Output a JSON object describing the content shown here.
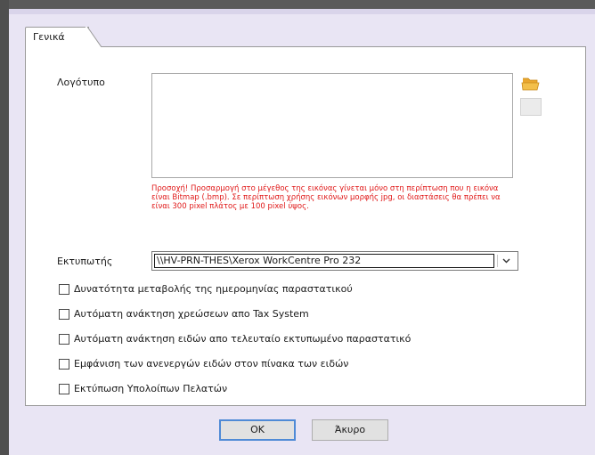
{
  "tabs": [
    {
      "label": "Γενικά",
      "active": true
    }
  ],
  "logo": {
    "label": "Λογότυπο",
    "warning": "Προσοχή! Προσαρμογή στο μέγεθος της εικόνας γίνεται μόνο στη περίπτωση που η εικόνα είναι Bitmap (.bmp). Σε περίπτωση χρήσης εικόνων μορφής jpg, οι διαστάσεις θα πρέπει να είναι 300 pixel πλάτος με 100 pixel ύψος.",
    "browse_icon": "folder-icon"
  },
  "printer": {
    "label": "Εκτυπωτής",
    "value": "\\\\HV-PRN-THES\\Xerox WorkCentre Pro 232"
  },
  "options": [
    {
      "label": "Δυνατότητα μεταβολής της ημερομηνίας παραστατικού",
      "checked": false
    },
    {
      "label": "Αυτόματη ανάκτηση χρεώσεων απο Tax System",
      "checked": false
    },
    {
      "label": "Αυτόματη ανάκτηση ειδών απο τελευταίο εκτυπωμένο παραστατικό",
      "checked": false
    },
    {
      "label": "Εμφάνιση των ανενεργών ειδών στον πίνακα των ειδών",
      "checked": false
    },
    {
      "label": "Εκτύπωση Υπολοίπων Πελατών",
      "checked": false
    }
  ],
  "buttons": {
    "ok": "OK",
    "cancel": "Άκυρο"
  },
  "colors": {
    "warning": "#e01818",
    "background": "#e9e5f4",
    "default_button_border": "#4f8ad6"
  }
}
